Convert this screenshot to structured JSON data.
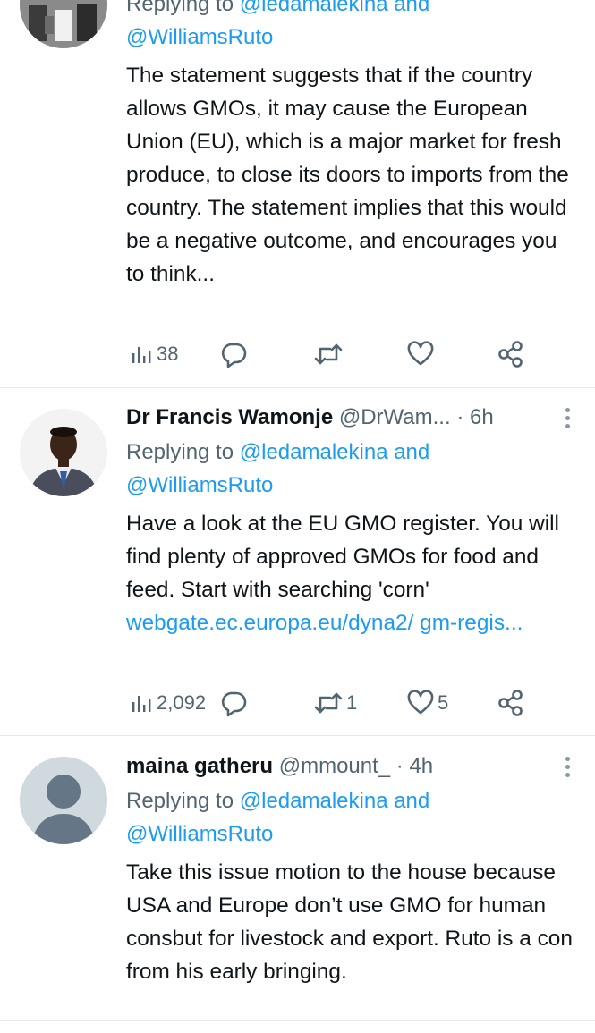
{
  "tweets": [
    {
      "replying_prefix": "Replying to ",
      "replying_handle": "@ledamalekina and",
      "replying_handle2": "@WilliamsRuto",
      "text": "The statement suggests that if the country allows GMOs, it may cause the European Union (EU), which is a major market for fresh produce, to close its doors to imports from the country. The statement implies that this would be a negative outcome, and encourages you to think...",
      "views": "38",
      "replies": "",
      "retweets": "",
      "likes": ""
    },
    {
      "name": "Dr Francis Wamonje",
      "handle": "@DrWam...",
      "time": "· 6h",
      "replying_prefix": "Replying to ",
      "replying_handle": "@ledamalekina and",
      "replying_handle2": "@WilliamsRuto",
      "text": "Have a look at the EU GMO register. You will find plenty of approved GMOs for food and feed. Start with searching 'corn' ",
      "link": "webgate.ec.europa.eu/dyna2/ gm-regis...",
      "views": "2,092",
      "replies": "",
      "retweets": "1",
      "likes": "5"
    },
    {
      "name": "maina gatheru",
      "handle": "@mmount_",
      "time": "· 4h",
      "replying_prefix": "Replying to ",
      "replying_handle": "@ledamalekina and",
      "replying_handle2": "@WilliamsRuto",
      "text": "Take this issue motion to the house because USA and Europe don’t use GMO for human consbut for livestock and export. Ruto is a con from his early bringing."
    }
  ],
  "colors": {
    "link": "#1d9bf0",
    "secondary": "#536471",
    "divider": "#e6e9ec"
  },
  "icons": [
    "views-icon",
    "reply-icon",
    "retweet-icon",
    "like-icon",
    "share-icon",
    "more-icon"
  ]
}
